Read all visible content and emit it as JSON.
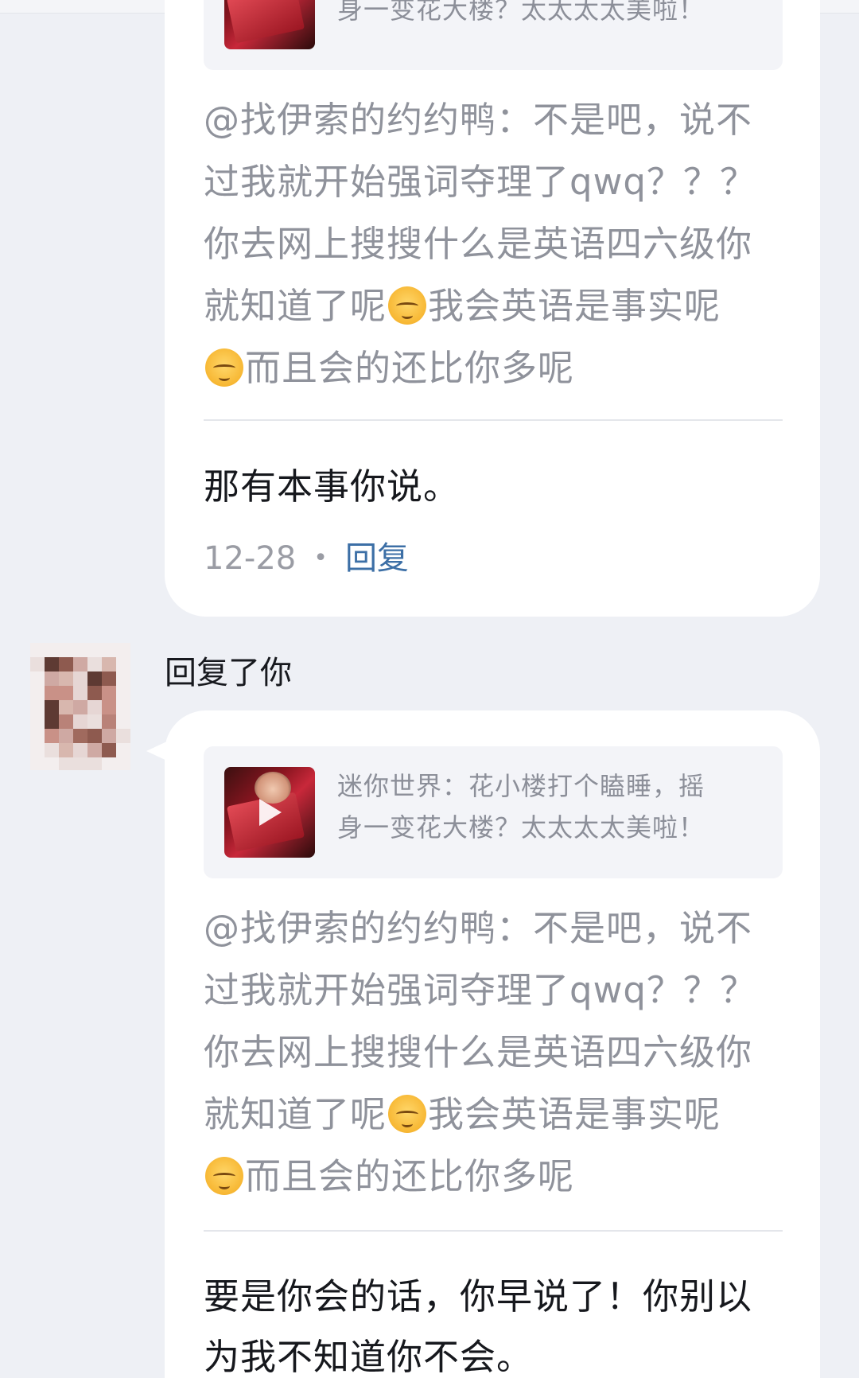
{
  "comments": [
    {
      "video_title_lines": [
        "身一变花大楼？太太太太美啦！"
      ],
      "quote_lines": [
        "@找伊索的约约鸭：不是吧，说不",
        "过我就开始强词夺理了qwq？？？",
        "你去网上搜搜什么是英语四六级你",
        "就知道了呢",
        "我会英语是事实呢",
        "而且会的还比你多呢"
      ],
      "reply_lines": [
        "那有本事你说。"
      ],
      "date": "12-28",
      "separator": "•",
      "reply_label": "回复"
    },
    {
      "header": "回复了你",
      "video_title_lines": [
        "迷你世界：花小楼打个瞌睡，摇",
        "身一变花大楼？太太太太美啦！"
      ],
      "quote_lines": [
        "@找伊索的约约鸭：不是吧，说不",
        "过我就开始强词夺理了qwq？？？",
        "你去网上搜搜什么是英语四六级你",
        "就知道了呢",
        "我会英语是事实呢",
        "而且会的还比你多呢"
      ],
      "reply_lines": [
        "要是你会的话，你早说了！你别以",
        "为我不知道你不会。"
      ]
    }
  ],
  "icons": {
    "emoji": "shy-smile-emoji-icon",
    "play": "play-icon",
    "avatar": "pixelated-avatar"
  },
  "colors": {
    "background": "#eef0f5",
    "bubble": "#ffffff",
    "quote_text": "#8f929b",
    "reply_text": "#16181d",
    "link": "#3c6fa6"
  }
}
